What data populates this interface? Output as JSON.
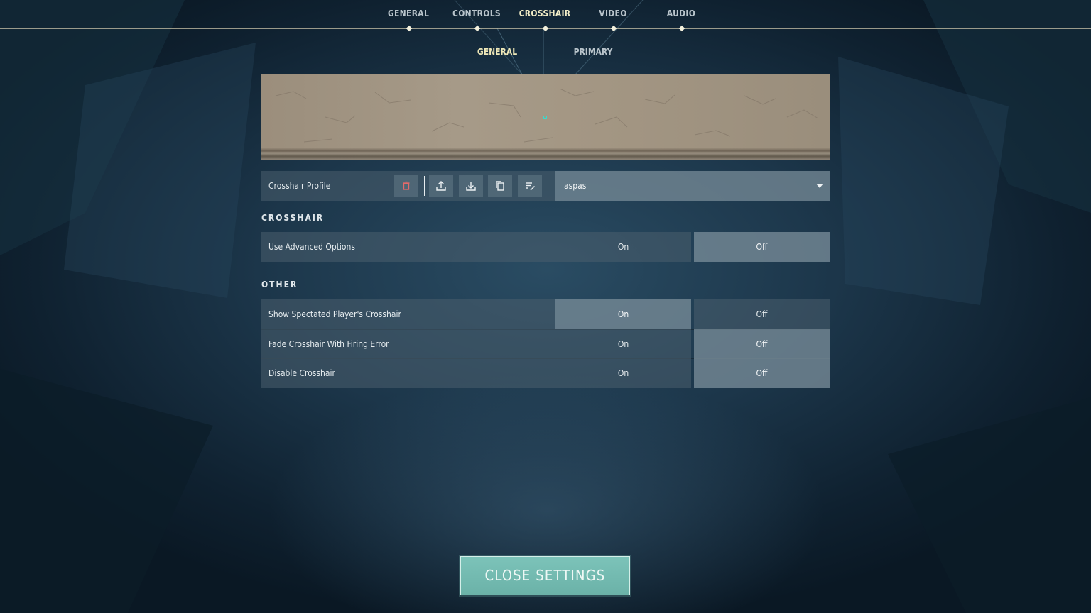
{
  "nav": {
    "tabs": [
      "GENERAL",
      "CONTROLS",
      "CROSSHAIR",
      "VIDEO",
      "AUDIO"
    ],
    "active_tab": "CROSSHAIR",
    "subtabs": [
      "GENERAL",
      "PRIMARY"
    ],
    "active_subtab": "GENERAL"
  },
  "profile": {
    "label": "Crosshair Profile",
    "icons": [
      "trash-icon",
      "upload-icon",
      "download-icon",
      "copy-icon",
      "rename-icon"
    ],
    "selected": "aspas"
  },
  "crosshair_section": {
    "title": "CROSSHAIR",
    "rows": [
      {
        "label": "Use Advanced Options",
        "on": "On",
        "off": "Off",
        "value": "Off"
      }
    ]
  },
  "other_section": {
    "title": "OTHER",
    "rows": [
      {
        "label": "Show Spectated Player's Crosshair",
        "on": "On",
        "off": "Off",
        "value": "On"
      },
      {
        "label": "Fade Crosshair With Firing Error",
        "on": "On",
        "off": "Off",
        "value": "Off"
      },
      {
        "label": "Disable Crosshair",
        "on": "On",
        "off": "Off",
        "value": "Off"
      }
    ]
  },
  "close_button": "CLOSE SETTINGS",
  "colors": {
    "accent_teal": "#6fb8ad",
    "active_tab": "#f1ecc6",
    "crosshair": "#2fe0d4"
  }
}
